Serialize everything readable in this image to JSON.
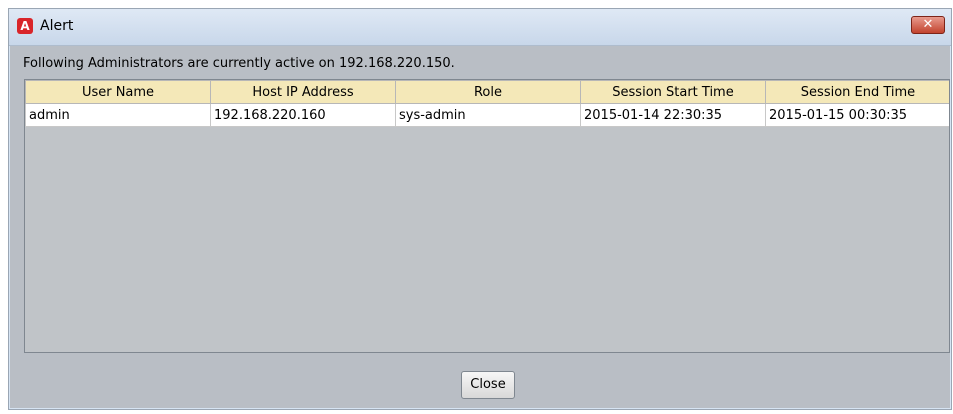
{
  "window": {
    "title": "Alert",
    "app_icon": "alert-app-icon",
    "app_icon_glyph": "A",
    "close_glyph": "✕"
  },
  "message": "Following Administrators are currently active on 192.168.220.150.",
  "table": {
    "columns": [
      "User Name",
      "Host IP Address",
      "Role",
      "Session Start Time",
      "Session End Time"
    ],
    "rows": [
      [
        "admin",
        "192.168.220.160",
        "sys-admin",
        "2015-01-14 22:30:35",
        "2015-01-15 00:30:35"
      ]
    ]
  },
  "buttons": {
    "close": "Close"
  },
  "colors": {
    "header_bg": "#f4e8b8",
    "panel_bg": "#b9bec5",
    "icon_red": "#d9252a"
  }
}
